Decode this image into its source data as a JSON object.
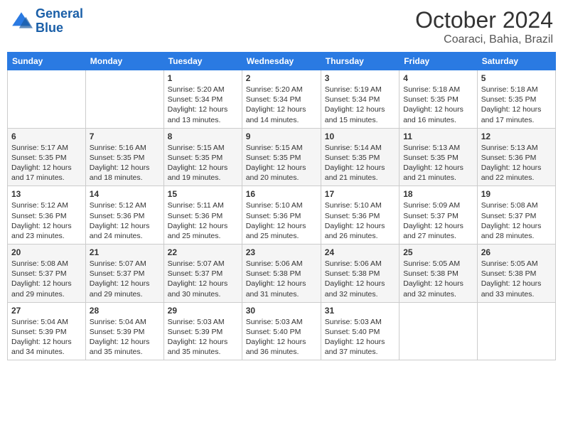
{
  "header": {
    "logo_line1": "General",
    "logo_line2": "Blue",
    "month": "October 2024",
    "location": "Coaraci, Bahia, Brazil"
  },
  "columns": [
    "Sunday",
    "Monday",
    "Tuesday",
    "Wednesday",
    "Thursday",
    "Friday",
    "Saturday"
  ],
  "weeks": [
    [
      {
        "day": "",
        "info": ""
      },
      {
        "day": "",
        "info": ""
      },
      {
        "day": "1",
        "info": "Sunrise: 5:20 AM\nSunset: 5:34 PM\nDaylight: 12 hours and 13 minutes."
      },
      {
        "day": "2",
        "info": "Sunrise: 5:20 AM\nSunset: 5:34 PM\nDaylight: 12 hours and 14 minutes."
      },
      {
        "day": "3",
        "info": "Sunrise: 5:19 AM\nSunset: 5:34 PM\nDaylight: 12 hours and 15 minutes."
      },
      {
        "day": "4",
        "info": "Sunrise: 5:18 AM\nSunset: 5:35 PM\nDaylight: 12 hours and 16 minutes."
      },
      {
        "day": "5",
        "info": "Sunrise: 5:18 AM\nSunset: 5:35 PM\nDaylight: 12 hours and 17 minutes."
      }
    ],
    [
      {
        "day": "6",
        "info": "Sunrise: 5:17 AM\nSunset: 5:35 PM\nDaylight: 12 hours and 17 minutes."
      },
      {
        "day": "7",
        "info": "Sunrise: 5:16 AM\nSunset: 5:35 PM\nDaylight: 12 hours and 18 minutes."
      },
      {
        "day": "8",
        "info": "Sunrise: 5:15 AM\nSunset: 5:35 PM\nDaylight: 12 hours and 19 minutes."
      },
      {
        "day": "9",
        "info": "Sunrise: 5:15 AM\nSunset: 5:35 PM\nDaylight: 12 hours and 20 minutes."
      },
      {
        "day": "10",
        "info": "Sunrise: 5:14 AM\nSunset: 5:35 PM\nDaylight: 12 hours and 21 minutes."
      },
      {
        "day": "11",
        "info": "Sunrise: 5:13 AM\nSunset: 5:35 PM\nDaylight: 12 hours and 21 minutes."
      },
      {
        "day": "12",
        "info": "Sunrise: 5:13 AM\nSunset: 5:36 PM\nDaylight: 12 hours and 22 minutes."
      }
    ],
    [
      {
        "day": "13",
        "info": "Sunrise: 5:12 AM\nSunset: 5:36 PM\nDaylight: 12 hours and 23 minutes."
      },
      {
        "day": "14",
        "info": "Sunrise: 5:12 AM\nSunset: 5:36 PM\nDaylight: 12 hours and 24 minutes."
      },
      {
        "day": "15",
        "info": "Sunrise: 5:11 AM\nSunset: 5:36 PM\nDaylight: 12 hours and 25 minutes."
      },
      {
        "day": "16",
        "info": "Sunrise: 5:10 AM\nSunset: 5:36 PM\nDaylight: 12 hours and 25 minutes."
      },
      {
        "day": "17",
        "info": "Sunrise: 5:10 AM\nSunset: 5:36 PM\nDaylight: 12 hours and 26 minutes."
      },
      {
        "day": "18",
        "info": "Sunrise: 5:09 AM\nSunset: 5:37 PM\nDaylight: 12 hours and 27 minutes."
      },
      {
        "day": "19",
        "info": "Sunrise: 5:08 AM\nSunset: 5:37 PM\nDaylight: 12 hours and 28 minutes."
      }
    ],
    [
      {
        "day": "20",
        "info": "Sunrise: 5:08 AM\nSunset: 5:37 PM\nDaylight: 12 hours and 29 minutes."
      },
      {
        "day": "21",
        "info": "Sunrise: 5:07 AM\nSunset: 5:37 PM\nDaylight: 12 hours and 29 minutes."
      },
      {
        "day": "22",
        "info": "Sunrise: 5:07 AM\nSunset: 5:37 PM\nDaylight: 12 hours and 30 minutes."
      },
      {
        "day": "23",
        "info": "Sunrise: 5:06 AM\nSunset: 5:38 PM\nDaylight: 12 hours and 31 minutes."
      },
      {
        "day": "24",
        "info": "Sunrise: 5:06 AM\nSunset: 5:38 PM\nDaylight: 12 hours and 32 minutes."
      },
      {
        "day": "25",
        "info": "Sunrise: 5:05 AM\nSunset: 5:38 PM\nDaylight: 12 hours and 32 minutes."
      },
      {
        "day": "26",
        "info": "Sunrise: 5:05 AM\nSunset: 5:38 PM\nDaylight: 12 hours and 33 minutes."
      }
    ],
    [
      {
        "day": "27",
        "info": "Sunrise: 5:04 AM\nSunset: 5:39 PM\nDaylight: 12 hours and 34 minutes."
      },
      {
        "day": "28",
        "info": "Sunrise: 5:04 AM\nSunset: 5:39 PM\nDaylight: 12 hours and 35 minutes."
      },
      {
        "day": "29",
        "info": "Sunrise: 5:03 AM\nSunset: 5:39 PM\nDaylight: 12 hours and 35 minutes."
      },
      {
        "day": "30",
        "info": "Sunrise: 5:03 AM\nSunset: 5:40 PM\nDaylight: 12 hours and 36 minutes."
      },
      {
        "day": "31",
        "info": "Sunrise: 5:03 AM\nSunset: 5:40 PM\nDaylight: 12 hours and 37 minutes."
      },
      {
        "day": "",
        "info": ""
      },
      {
        "day": "",
        "info": ""
      }
    ]
  ]
}
